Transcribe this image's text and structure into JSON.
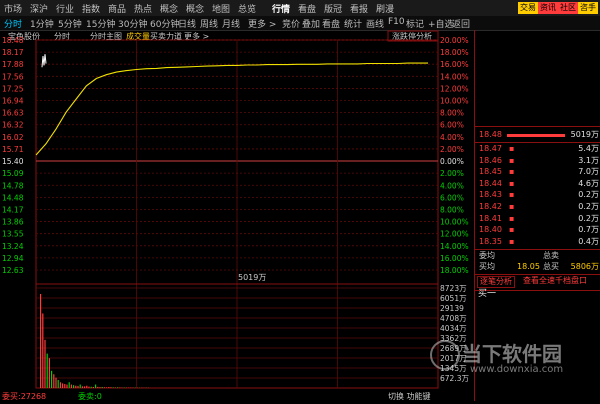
{
  "menu": {
    "items": [
      "市场",
      "深沪",
      "行业",
      "指数",
      "商品",
      "热点",
      "概念",
      "概念",
      "地图",
      "总览",
      "行情",
      "看盘",
      "版冠",
      "看报",
      "刷漫"
    ],
    "active_index": 10,
    "right_buttons": [
      {
        "label": "交易",
        "color": "#ffcc00"
      },
      {
        "label": "资讯",
        "color": "#ff3b3b"
      },
      {
        "label": "社区",
        "color": "#ff3b3b"
      },
      {
        "label": "咨手",
        "color": "#ffcc00"
      }
    ]
  },
  "periods": {
    "items": [
      "分时",
      "1分钟",
      "5分钟",
      "15分钟",
      "30分钟",
      "60分钟",
      "日线",
      "周线",
      "月线",
      "更多 >"
    ],
    "selected_index": 0,
    "tools": [
      "竞价",
      "叠加",
      "看盘",
      "统计",
      "画线",
      "F10",
      "标记",
      "+自选",
      "返回"
    ]
  },
  "chart_header": {
    "items": [
      "宝色股份",
      "分时",
      "分时主图",
      "成交量",
      "买卖力道",
      "更多 >"
    ],
    "highlight_index": 3,
    "right_label": "涨跌停分析"
  },
  "chart_data": {
    "type": "line",
    "price_ticks": [
      "18.48",
      "18.17",
      "17.88",
      "17.56",
      "17.25",
      "16.94",
      "16.63",
      "16.32",
      "16.02",
      "15.71",
      "15.40",
      "15.09",
      "14.78",
      "14.48",
      "14.17",
      "13.86",
      "13.55",
      "13.24",
      "12.94",
      "12.63"
    ],
    "pct_ticks": [
      "20.00%",
      "18.00%",
      "16.00%",
      "14.00%",
      "12.00%",
      "10.00%",
      "8.00%",
      "6.00%",
      "4.00%",
      "2.00%",
      "0.00%",
      "2.00%",
      "4.00%",
      "6.00%",
      "8.00%",
      "10.00%",
      "12.00%",
      "14.00%",
      "16.00%",
      "18.00%"
    ],
    "prev_close": 15.4,
    "ylim": [
      12.32,
      18.48
    ],
    "price_series": [
      15.4,
      15.7,
      16.1,
      16.55,
      16.9,
      17.25,
      17.45,
      17.55,
      17.62,
      17.66,
      17.69,
      17.71,
      17.72,
      17.74,
      17.75,
      17.76,
      17.77,
      17.78,
      17.79,
      17.8,
      17.8,
      17.81,
      17.81,
      17.82,
      17.82,
      17.82,
      17.83,
      17.83,
      17.83,
      17.84,
      17.84,
      17.84,
      17.84,
      17.85,
      17.85,
      17.85,
      17.85,
      17.86,
      17.86,
      17.86
    ],
    "volume_label": "5019万",
    "volume_ticks": [
      "8723万",
      "6051万",
      "29139",
      "4708万",
      "4034万",
      "3362万",
      "2689万",
      "2017万",
      "1345万",
      "672.3万"
    ],
    "volume_ylim": [
      0,
      8723
    ],
    "volume_series": [
      8200,
      6500,
      4200,
      3000,
      2600,
      1500,
      1200,
      900,
      700,
      500,
      400,
      350,
      300,
      500,
      300,
      250,
      200,
      180,
      300,
      150,
      140,
      200,
      120,
      110,
      90,
      300,
      100,
      80,
      90,
      70,
      60,
      80,
      70,
      60,
      50,
      60,
      50,
      40,
      45,
      40,
      35,
      40,
      30,
      35,
      30,
      28,
      30,
      25,
      28,
      25
    ],
    "volume_colors": [
      "#ff3b3b",
      "#ff3b3b",
      "#ff3b3b",
      "#00d000",
      "#ff3b3b",
      "#00d000",
      "#ff3b3b",
      "#ff3b3b",
      "#00d000",
      "#ff3b3b"
    ],
    "bottom_left": "委买:27268",
    "bottom_left2": "委卖:0",
    "bottom_right": "切换 功能键"
  },
  "orderbook": {
    "sells": [
      {
        "price": "18.48",
        "amount": "5019万",
        "bar": 1.0
      }
    ],
    "buys": [
      {
        "price": "18.47",
        "amount": "5.4万"
      },
      {
        "price": "18.46",
        "amount": "3.1万"
      },
      {
        "price": "18.45",
        "amount": "7.0万"
      },
      {
        "price": "18.44",
        "amount": "4.6万"
      },
      {
        "price": "18.43",
        "amount": "0.2万"
      },
      {
        "price": "18.42",
        "amount": "0.2万"
      },
      {
        "price": "18.41",
        "amount": "0.2万"
      },
      {
        "price": "18.40",
        "amount": "0.7万"
      },
      {
        "price": "18.35",
        "amount": "0.4万"
      }
    ],
    "stats": {
      "wei_jun_label": "委均",
      "zong_mai_label": "总卖",
      "mai_jun_label": "买均",
      "mai_jun_value": "18.05",
      "zong_mai2_label": "总买",
      "zong_mai2_value": "5806万"
    },
    "tabs": [
      "逐笔分析",
      "查看全速千档盘口"
    ],
    "queue_label": "买一"
  },
  "watermark": {
    "title": "当下软件园",
    "url": "www.downxia.com"
  }
}
